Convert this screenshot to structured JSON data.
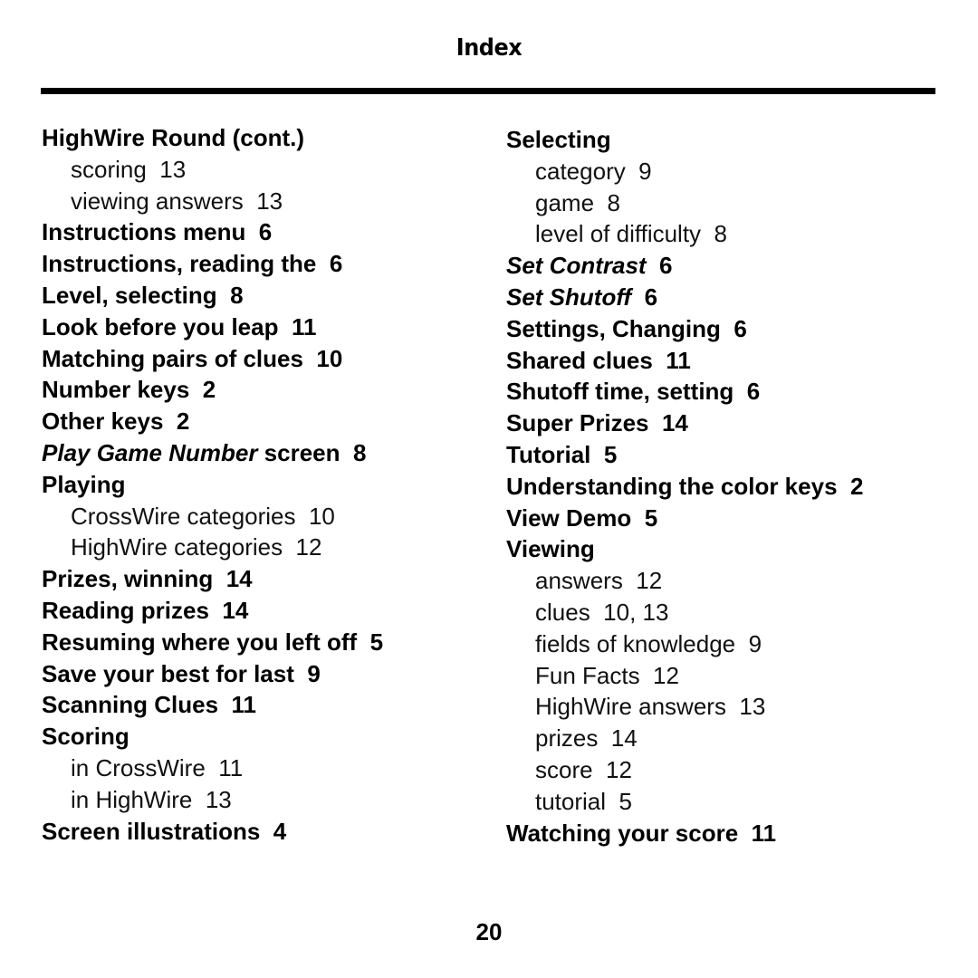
{
  "header": {
    "title": "Index"
  },
  "page_number": "20",
  "left_column": [
    {
      "type": "main",
      "text": "HighWire Round (cont.)",
      "page": ""
    },
    {
      "type": "sub",
      "text": "scoring",
      "page": "13"
    },
    {
      "type": "sub",
      "text": "viewing answers",
      "page": "13"
    },
    {
      "type": "main",
      "text": "Instructions menu",
      "page": "6"
    },
    {
      "type": "main",
      "text": "Instructions, reading the",
      "page": "6"
    },
    {
      "type": "main",
      "text": "Level, selecting",
      "page": "8"
    },
    {
      "type": "main",
      "text": "Look before you leap",
      "page": "11"
    },
    {
      "type": "main",
      "text": "Matching pairs of clues",
      "page": "10"
    },
    {
      "type": "main",
      "text": "Number keys",
      "page": "2"
    },
    {
      "type": "main",
      "text": "Other keys",
      "page": "2"
    },
    {
      "type": "main",
      "italic": "Play Game Number",
      "text": " screen",
      "page": "8"
    },
    {
      "type": "main",
      "text": "Playing",
      "page": ""
    },
    {
      "type": "sub",
      "text": "CrossWire categories",
      "page": "10"
    },
    {
      "type": "sub",
      "text": "HighWire categories",
      "page": "12"
    },
    {
      "type": "main",
      "text": "Prizes, winning",
      "page": "14"
    },
    {
      "type": "main",
      "text": "Reading prizes",
      "page": "14"
    },
    {
      "type": "main",
      "text": "Resuming where you left off",
      "page": "5"
    },
    {
      "type": "main",
      "text": "Save your best for last",
      "page": "9"
    },
    {
      "type": "main",
      "text": "Scanning Clues",
      "page": "11"
    },
    {
      "type": "main",
      "text": "Scoring",
      "page": ""
    },
    {
      "type": "sub",
      "text": "in CrossWire",
      "page": "11"
    },
    {
      "type": "sub",
      "text": "in HighWire",
      "page": "13"
    },
    {
      "type": "main",
      "text": "Screen illustrations",
      "page": "4"
    }
  ],
  "right_column": [
    {
      "type": "main",
      "text": "Selecting",
      "page": ""
    },
    {
      "type": "sub",
      "text": "category",
      "page": "9"
    },
    {
      "type": "sub",
      "text": "game",
      "page": "8"
    },
    {
      "type": "sub",
      "text": "level of difficulty",
      "page": "8"
    },
    {
      "type": "main",
      "italic": "Set Contrast",
      "text": "",
      "page": "6"
    },
    {
      "type": "main",
      "italic": "Set Shutoff",
      "text": "",
      "page": "6"
    },
    {
      "type": "main",
      "text": "Settings, Changing",
      "page": "6"
    },
    {
      "type": "main",
      "text": "Shared clues",
      "page": "11"
    },
    {
      "type": "main",
      "text": "Shutoff time, setting",
      "page": "6"
    },
    {
      "type": "main",
      "text": "Super Prizes",
      "page": "14"
    },
    {
      "type": "main",
      "text": "Tutorial",
      "page": "5"
    },
    {
      "type": "main",
      "text": "Understanding the color keys",
      "page": "2"
    },
    {
      "type": "main",
      "text": "View Demo",
      "page": "5"
    },
    {
      "type": "main",
      "text": "Viewing",
      "page": ""
    },
    {
      "type": "sub",
      "text": "answers",
      "page": "12"
    },
    {
      "type": "sub",
      "text": "clues",
      "page": "10, 13"
    },
    {
      "type": "sub",
      "text": "fields of knowledge",
      "page": "9"
    },
    {
      "type": "sub",
      "text": "Fun Facts",
      "page": "12"
    },
    {
      "type": "sub",
      "text": "HighWire answers",
      "page": "13"
    },
    {
      "type": "sub",
      "text": "prizes",
      "page": "14"
    },
    {
      "type": "sub",
      "text": "score",
      "page": "12"
    },
    {
      "type": "sub",
      "text": "tutorial",
      "page": "5"
    },
    {
      "type": "main",
      "text": "Watching your score",
      "page": "11"
    }
  ]
}
